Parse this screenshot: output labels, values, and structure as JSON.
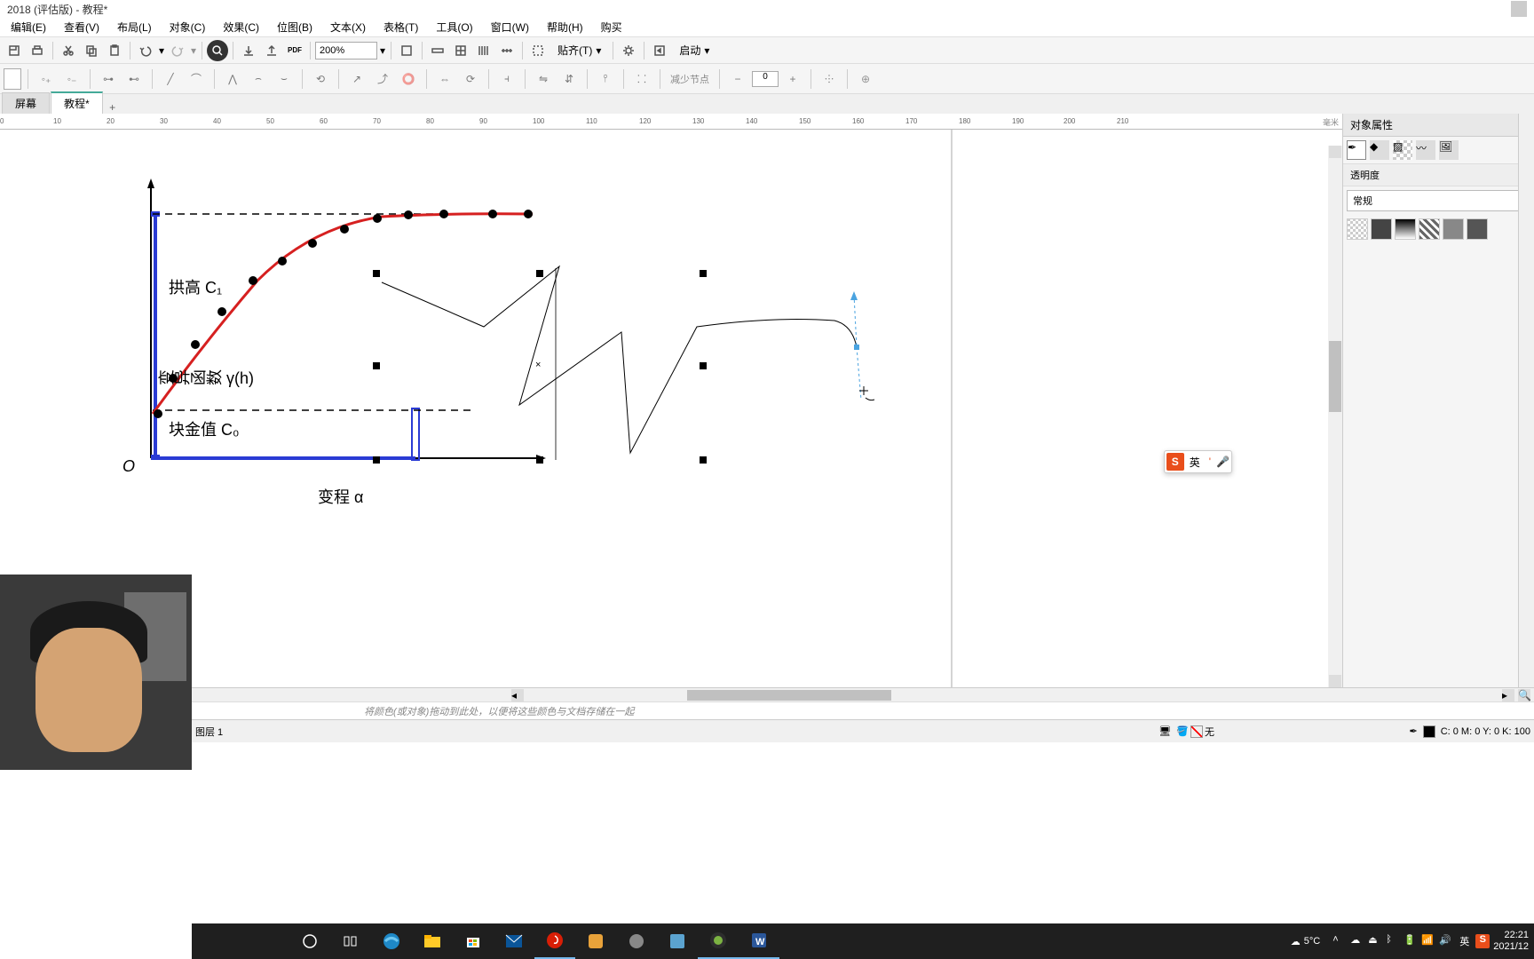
{
  "title_bar": {
    "title": "2018 (评估版) - 教程*"
  },
  "menu": {
    "edit": "编辑(E)",
    "view": "查看(V)",
    "layout": "布局(L)",
    "object": "对象(C)",
    "effect": "效果(C)",
    "bitmap": "位图(B)",
    "text": "文本(X)",
    "table": "表格(T)",
    "tool": "工具(O)",
    "window": "窗口(W)",
    "help": "帮助(H)",
    "buy": "购买"
  },
  "toolbar1": {
    "zoom": "200%",
    "pdf": "PDF",
    "snap": "贴齐(T)",
    "launch": "启动"
  },
  "toolbar2": {
    "reduce_nodes": "减少节点",
    "nodes_value": "0"
  },
  "tabs": {
    "welcome": "屏幕",
    "tutorial": "教程*",
    "add": "+"
  },
  "ruler": {
    "ticks": [
      "0",
      "10",
      "20",
      "30",
      "40",
      "50",
      "60",
      "70",
      "80",
      "90",
      "100",
      "110",
      "120",
      "130",
      "140",
      "150",
      "160",
      "170",
      "180",
      "190",
      "200",
      "210"
    ],
    "unit": "毫米"
  },
  "chart_data": {
    "type": "line",
    "title": "",
    "xlabel": "变程 α",
    "ylabel": "变异函数 γ(h)",
    "origin_label": "O",
    "annotations": {
      "sill": "拱高 C₁",
      "nugget": "块金值 C₀"
    },
    "x": [
      0.05,
      0.1,
      0.15,
      0.22,
      0.3,
      0.4,
      0.5,
      0.6,
      0.7,
      0.8,
      0.9,
      1.0
    ],
    "y": [
      0.1,
      0.22,
      0.38,
      0.55,
      0.72,
      0.86,
      0.94,
      0.98,
      0.99,
      1.0,
      1.0,
      1.0
    ],
    "xlim": [
      0,
      1.0
    ],
    "ylim": [
      0,
      1.05
    ],
    "nugget_y": 0.1,
    "sill_y": 1.0,
    "range_x": 0.7
  },
  "side_panel": {
    "title": "对象属性",
    "transparency": "透明度",
    "normal": "常规"
  },
  "color_bar": {
    "hint": "将颜色(或对象)拖动到此处，以便将这些颜色与文档存储在一起"
  },
  "status": {
    "layer": "图层 1",
    "fill_none": "无",
    "color_readout": "C: 0 M: 0 Y: 0 K: 100"
  },
  "ime": {
    "brand": "S",
    "mode": "英",
    "sep": "'",
    "mic": "🎤"
  },
  "taskbar": {
    "weather_temp": "5°C",
    "ime_lang": "英",
    "time": "22:21",
    "date": "2021/12"
  }
}
